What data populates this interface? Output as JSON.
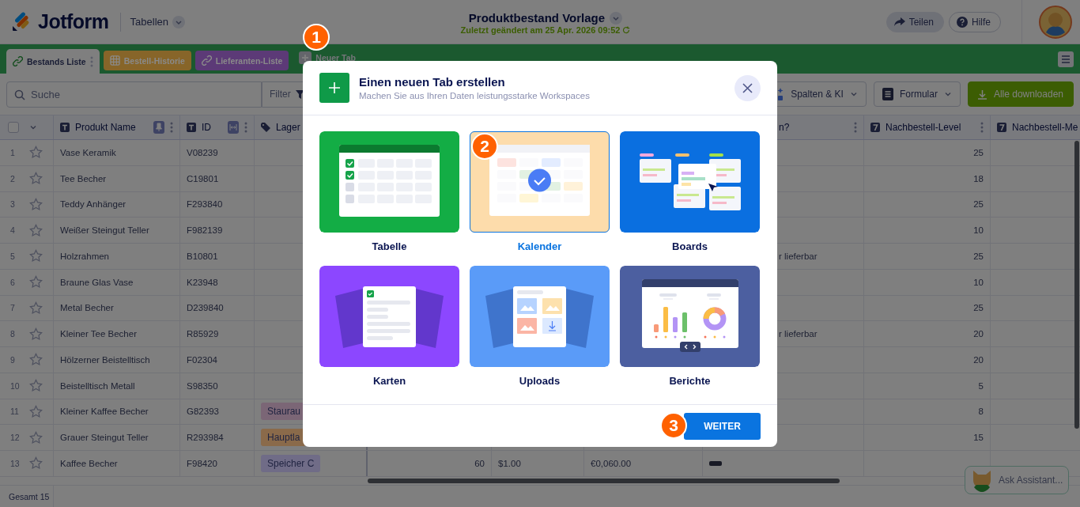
{
  "header": {
    "logo": "Jotform",
    "product": "Tabellen",
    "title": "Produktbestand Vorlage",
    "subtitle": "Zuletzt geändert am 25 Apr. 2026 09:52",
    "actions": [
      {
        "label": "Teilen",
        "kind": "share"
      },
      {
        "label": "Hilfe",
        "kind": "help"
      }
    ]
  },
  "tabs": [
    {
      "label": "Bestands Liste",
      "kind": "link",
      "selected": true
    },
    {
      "label": "Bestell-Historie",
      "kind": "grid",
      "color": "#876529",
      "selected": false
    },
    {
      "label": "Lieferanten-Liste",
      "kind": "link",
      "color": "#5c3a77",
      "selected": false
    },
    {
      "label": "Neuer Tab",
      "kind": "add",
      "selected": false
    }
  ],
  "toolbar": {
    "search": {
      "placeholder": "Suche"
    },
    "filter": "Filter",
    "buttons": [
      {
        "label": "Spalten & KI",
        "kind": "columns"
      },
      {
        "label": "Formular",
        "kind": "form"
      },
      {
        "label": "Alle downloaden",
        "kind": "download"
      }
    ]
  },
  "table": {
    "columns": [
      {
        "label": "Produkt Name",
        "kind": "text"
      },
      {
        "label": "ID",
        "kind": "text"
      },
      {
        "label": "Lager",
        "kind": "tag"
      },
      {
        "kind": "number"
      },
      {
        "kind": "currency"
      },
      {
        "kind": "currency"
      },
      {
        "label": "n?",
        "kind": "choice"
      },
      {
        "label": "Nachbestell-Level",
        "kind": "number"
      },
      {
        "label": "Nachbestell-Me",
        "kind": "number"
      }
    ],
    "rows": [
      {
        "number": "1",
        "starred": false,
        "cells": [
          "Vase Keramik",
          "V08239",
          null,
          null,
          null,
          null,
          null,
          "25",
          null
        ]
      },
      {
        "number": "2",
        "starred": false,
        "cells": [
          "Tee Becher",
          "C19801",
          null,
          null,
          null,
          null,
          null,
          "18",
          null
        ]
      },
      {
        "number": "3",
        "starred": false,
        "cells": [
          "Teddy Anhänger",
          "F293840",
          null,
          null,
          null,
          null,
          null,
          "25",
          null
        ]
      },
      {
        "number": "4",
        "starred": false,
        "cells": [
          "Weißer Steingut Teller",
          "F982139",
          null,
          null,
          null,
          null,
          null,
          "10",
          null
        ]
      },
      {
        "number": "5",
        "starred": false,
        "cells": [
          "Holzrahmen",
          "B10801",
          null,
          null,
          null,
          null,
          "r lieferbar",
          "25",
          null
        ]
      },
      {
        "number": "6",
        "starred": false,
        "cells": [
          "Braune Glas Vase",
          "K23948",
          null,
          null,
          null,
          null,
          null,
          "10",
          null
        ]
      },
      {
        "number": "7",
        "starred": false,
        "cells": [
          "Metal Becher",
          "D239840",
          null,
          null,
          null,
          null,
          null,
          "25",
          null
        ]
      },
      {
        "number": "8",
        "starred": false,
        "cells": [
          "Kleiner Tee Becher",
          "R85929",
          null,
          null,
          null,
          null,
          "r lieferbar",
          "20",
          null
        ]
      },
      {
        "number": "9",
        "starred": false,
        "cells": [
          "Hölzerner Beistelltisch",
          "F02304",
          null,
          null,
          null,
          null,
          null,
          "20",
          null
        ]
      },
      {
        "number": "10",
        "starred": false,
        "cells": [
          "Beistelltisch Metall",
          "S98350",
          null,
          null,
          null,
          null,
          null,
          "5",
          null
        ]
      },
      {
        "number": "11",
        "starred": false,
        "cells": [
          "Kleiner Kaffee Becher",
          "G82393",
          {
            "text": "Staurau",
            "color": "#7b6676"
          },
          null,
          null,
          null,
          null,
          "8",
          null
        ]
      },
      {
        "number": "12",
        "starred": false,
        "cells": [
          "Grauer Steingut Teller",
          "R293984",
          {
            "text": "Hauptla",
            "color": "#8a6a4a"
          },
          null,
          null,
          null,
          null,
          "15",
          null
        ]
      },
      {
        "number": "13",
        "starred": false,
        "cells": [
          "Kaffee Becher",
          "F98420",
          {
            "text": "Speicher C",
            "color": "#706c87"
          },
          "60",
          "$1.00",
          "€0,060.00",
          {
            "kind": "dash"
          },
          null,
          null
        ]
      }
    ],
    "select_all_checked": false,
    "total": "Gesamt 15"
  },
  "assistant": {
    "label": "Ask Assistant..."
  },
  "modal": {
    "title": "Einen neuen Tab erstellen",
    "subtitle": "Machen Sie aus Ihren Daten leistungsstarke Workspaces",
    "options": [
      {
        "label": "Tabelle",
        "kind": "table",
        "selected": false
      },
      {
        "label": "Kalender",
        "kind": "calendar",
        "selected": true
      },
      {
        "label": "Boards",
        "kind": "boards",
        "selected": false
      },
      {
        "label": "Karten",
        "kind": "cards",
        "selected": false
      },
      {
        "label": "Uploads",
        "kind": "uploads",
        "selected": false
      },
      {
        "label": "Berichte",
        "kind": "report",
        "selected": false
      }
    ],
    "confirm": "WEITER"
  },
  "steps": [
    "1",
    "2",
    "3"
  ]
}
